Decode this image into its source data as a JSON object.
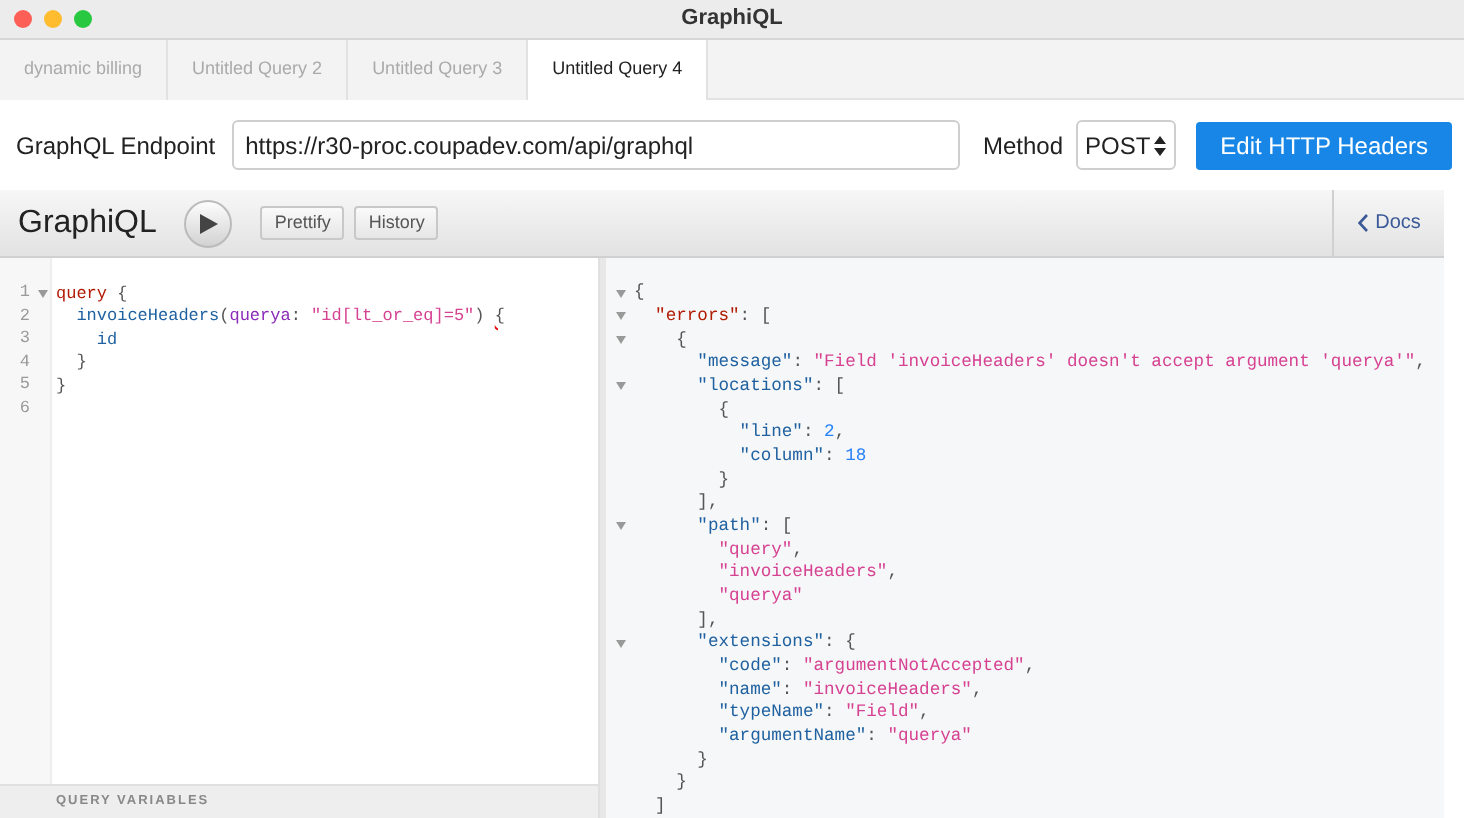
{
  "window": {
    "title": "GraphiQL"
  },
  "tabs": [
    {
      "label": "dynamic billing",
      "selected": false
    },
    {
      "label": "Untitled Query 2",
      "selected": false
    },
    {
      "label": "Untitled Query 3",
      "selected": false
    },
    {
      "label": "Untitled Query 4",
      "selected": true
    }
  ],
  "endpoint": {
    "label": "GraphQL Endpoint",
    "value": "https://r30-proc.coupadev.com/api/graphql"
  },
  "method": {
    "label": "Method",
    "value": "POST"
  },
  "edit_headers_button": "Edit HTTP Headers",
  "toolbar": {
    "logo": "GraphiQL",
    "buttons": [
      "Prettify",
      "History"
    ],
    "docs": "Docs"
  },
  "query_lines": [
    {
      "number": "1",
      "foldable": true,
      "tokens": [
        {
          "kind": "keyword",
          "text": "query"
        },
        {
          "kind": "punct",
          "text": " {"
        }
      ]
    },
    {
      "number": "2",
      "foldable": false,
      "tokens": [
        {
          "kind": "property",
          "text": "  invoiceHeaders"
        },
        {
          "kind": "punct",
          "text": "("
        },
        {
          "kind": "attribute",
          "text": "querya"
        },
        {
          "kind": "punct",
          "text": ": "
        },
        {
          "kind": "string",
          "text": "\"id[lt_or_eq]=5\""
        },
        {
          "kind": "punct",
          "text": ") "
        },
        {
          "kind": "error",
          "text": "{"
        }
      ]
    },
    {
      "number": "3",
      "foldable": false,
      "tokens": [
        {
          "kind": "property",
          "text": "    id"
        }
      ]
    },
    {
      "number": "4",
      "foldable": false,
      "tokens": [
        {
          "kind": "punct",
          "text": "  }"
        }
      ]
    },
    {
      "number": "5",
      "foldable": false,
      "tokens": [
        {
          "kind": "punct",
          "text": "}"
        }
      ]
    },
    {
      "number": "6",
      "foldable": false
    }
  ],
  "query_variables_label": "QUERY VARIABLES",
  "result_lines": [
    {
      "foldable": true,
      "tokens": [
        {
          "kind": "punct",
          "text": "{"
        }
      ]
    },
    {
      "foldable": true,
      "tokens": [
        {
          "kind": "keyword",
          "text": "  \"errors\""
        },
        {
          "kind": "punct",
          "text": ": ["
        }
      ]
    },
    {
      "foldable": true,
      "tokens": [
        {
          "kind": "punct",
          "text": "    {"
        }
      ]
    },
    {
      "foldable": false,
      "tokens": [
        {
          "kind": "property",
          "text": "      \"message\""
        },
        {
          "kind": "punct",
          "text": ": "
        },
        {
          "kind": "string",
          "text": "\"Field 'invoiceHeaders' doesn't accept argument 'querya'\""
        },
        {
          "kind": "punct",
          "text": ","
        }
      ]
    },
    {
      "foldable": true,
      "tokens": [
        {
          "kind": "property",
          "text": "      \"locations\""
        },
        {
          "kind": "punct",
          "text": ": ["
        }
      ]
    },
    {
      "foldable": false,
      "tokens": [
        {
          "kind": "punct",
          "text": "        {"
        }
      ]
    },
    {
      "foldable": false,
      "tokens": [
        {
          "kind": "property",
          "text": "          \"line\""
        },
        {
          "kind": "punct",
          "text": ": "
        },
        {
          "kind": "number",
          "text": "2"
        },
        {
          "kind": "punct",
          "text": ","
        }
      ]
    },
    {
      "foldable": false,
      "tokens": [
        {
          "kind": "property",
          "text": "          \"column\""
        },
        {
          "kind": "punct",
          "text": ": "
        },
        {
          "kind": "number",
          "text": "18"
        }
      ]
    },
    {
      "foldable": false,
      "tokens": [
        {
          "kind": "punct",
          "text": "        }"
        }
      ]
    },
    {
      "foldable": false,
      "tokens": [
        {
          "kind": "punct",
          "text": "      ],"
        }
      ]
    },
    {
      "foldable": true,
      "tokens": [
        {
          "kind": "property",
          "text": "      \"path\""
        },
        {
          "kind": "punct",
          "text": ": ["
        }
      ]
    },
    {
      "foldable": false,
      "tokens": [
        {
          "kind": "string",
          "text": "        \"query\""
        },
        {
          "kind": "punct",
          "text": ","
        }
      ]
    },
    {
      "foldable": false,
      "tokens": [
        {
          "kind": "string",
          "text": "        \"invoiceHeaders\""
        },
        {
          "kind": "punct",
          "text": ","
        }
      ]
    },
    {
      "foldable": false,
      "tokens": [
        {
          "kind": "string",
          "text": "        \"querya\""
        }
      ]
    },
    {
      "foldable": false,
      "tokens": [
        {
          "kind": "punct",
          "text": "      ],"
        }
      ]
    },
    {
      "foldable": true,
      "tokens": [
        {
          "kind": "property",
          "text": "      \"extensions\""
        },
        {
          "kind": "punct",
          "text": ": {"
        }
      ]
    },
    {
      "foldable": false,
      "tokens": [
        {
          "kind": "property",
          "text": "        \"code\""
        },
        {
          "kind": "punct",
          "text": ": "
        },
        {
          "kind": "string",
          "text": "\"argumentNotAccepted\""
        },
        {
          "kind": "punct",
          "text": ","
        }
      ]
    },
    {
      "foldable": false,
      "tokens": [
        {
          "kind": "property",
          "text": "        \"name\""
        },
        {
          "kind": "punct",
          "text": ": "
        },
        {
          "kind": "string",
          "text": "\"invoiceHeaders\""
        },
        {
          "kind": "punct",
          "text": ","
        }
      ]
    },
    {
      "foldable": false,
      "tokens": [
        {
          "kind": "property",
          "text": "        \"typeName\""
        },
        {
          "kind": "punct",
          "text": ": "
        },
        {
          "kind": "string",
          "text": "\"Field\""
        },
        {
          "kind": "punct",
          "text": ","
        }
      ]
    },
    {
      "foldable": false,
      "tokens": [
        {
          "kind": "property",
          "text": "        \"argumentName\""
        },
        {
          "kind": "punct",
          "text": ": "
        },
        {
          "kind": "string",
          "text": "\"querya\""
        }
      ]
    },
    {
      "foldable": false,
      "tokens": [
        {
          "kind": "punct",
          "text": "      }"
        }
      ]
    },
    {
      "foldable": false,
      "tokens": [
        {
          "kind": "punct",
          "text": "    }"
        }
      ]
    },
    {
      "foldable": false,
      "tokens": [
        {
          "kind": "punct",
          "text": "  ]"
        }
      ]
    }
  ]
}
